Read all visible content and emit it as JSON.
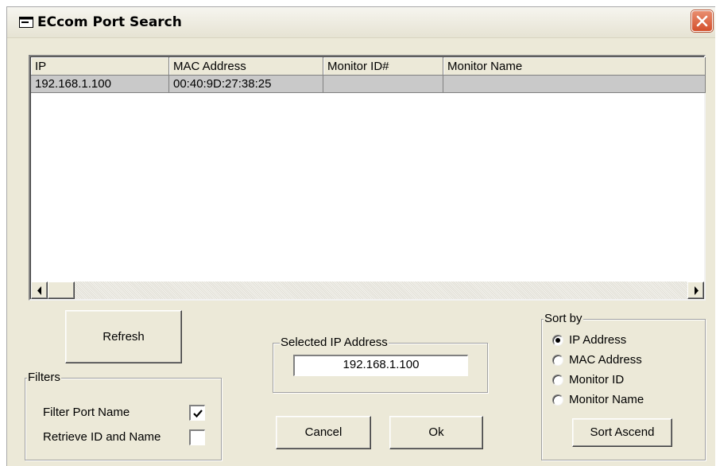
{
  "window": {
    "title": "ECcom Port Search"
  },
  "table": {
    "columns": [
      "IP",
      "MAC Address",
      "Monitor ID#",
      "Monitor Name"
    ],
    "rows": [
      [
        "192.168.1.100",
        "00:40:9D:27:38:25",
        "",
        ""
      ]
    ]
  },
  "buttons": {
    "refresh": "Refresh",
    "cancel": "Cancel",
    "ok": "Ok",
    "sort_ascend": "Sort Ascend"
  },
  "selected_ip": {
    "label": "Selected IP Address",
    "value": "192.168.1.100"
  },
  "filters": {
    "label": "Filters",
    "filter_port_name": {
      "label": "Filter Port Name",
      "checked": true
    },
    "retrieve_id_name": {
      "label": "Retrieve ID and Name",
      "checked": false
    }
  },
  "sort_by": {
    "label": "Sort by",
    "options": [
      "IP Address",
      "MAC Address",
      "Monitor ID",
      "Monitor Name"
    ],
    "selected": "IP Address"
  },
  "icons": {
    "window": "window-icon",
    "close": "close-icon",
    "scroll_left": "arrow-left-icon",
    "scroll_right": "arrow-right-icon",
    "checkmark": "checkmark-icon"
  },
  "colors": {
    "close_button": "#d4502c",
    "selected_row": "#c9c9c9",
    "dialog_bg": "#ece9d8"
  }
}
